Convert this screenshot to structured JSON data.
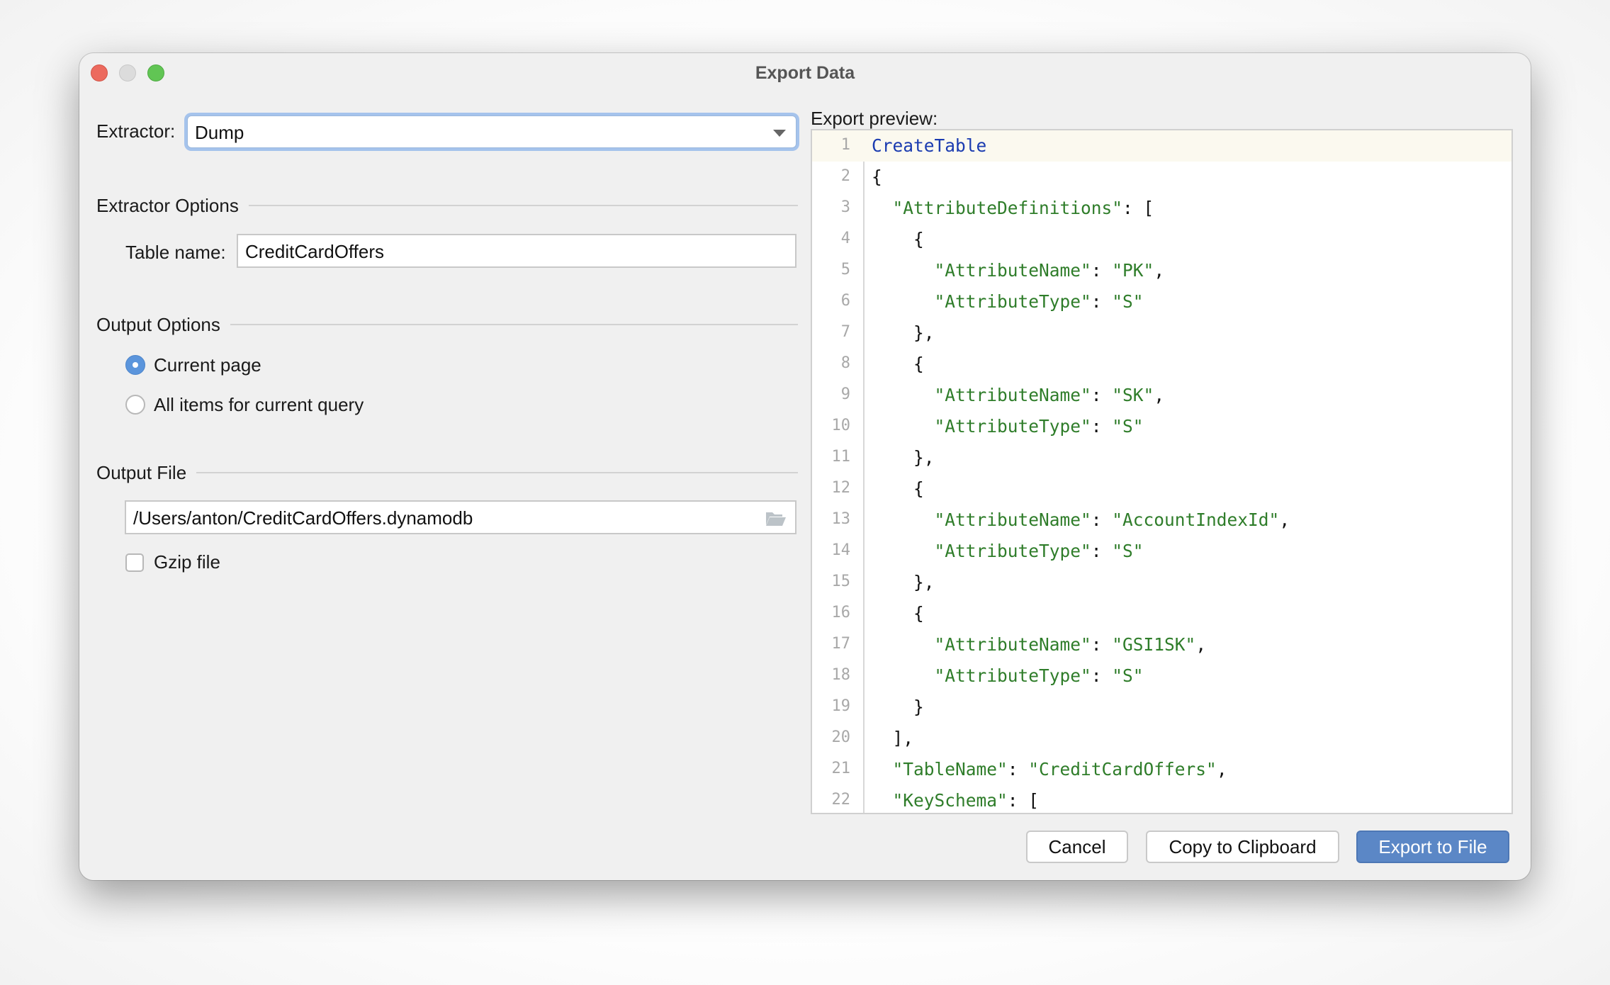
{
  "window": {
    "title": "Export Data",
    "controls": [
      "close",
      "minimize",
      "zoom"
    ]
  },
  "extractor": {
    "label": "Extractor:",
    "selected": "Dump"
  },
  "extractor_options": {
    "heading": "Extractor Options",
    "table_name_label": "Table name:",
    "table_name_value": "CreditCardOffers"
  },
  "output_options": {
    "heading": "Output Options",
    "radios": [
      {
        "label": "Current page",
        "selected": true
      },
      {
        "label": "All items for current query",
        "selected": false
      }
    ]
  },
  "output_file": {
    "heading": "Output File",
    "path": "/Users/anton/CreditCardOffers.dynamodb",
    "browse_icon": "folder-icon",
    "gzip_label": "Gzip file",
    "gzip_checked": false
  },
  "preview": {
    "label": "Export preview:",
    "current_line": 1,
    "lines": [
      {
        "n": "1",
        "tokens": [
          [
            "kw",
            "CreateTable"
          ]
        ]
      },
      {
        "n": "2",
        "tokens": [
          [
            "pun",
            "{"
          ]
        ]
      },
      {
        "n": "3",
        "tokens": [
          [
            "pun",
            "  "
          ],
          [
            "str",
            "\"AttributeDefinitions\""
          ],
          [
            "pun",
            ": ["
          ]
        ]
      },
      {
        "n": "4",
        "tokens": [
          [
            "pun",
            "    {"
          ]
        ]
      },
      {
        "n": "5",
        "tokens": [
          [
            "pun",
            "      "
          ],
          [
            "str",
            "\"AttributeName\""
          ],
          [
            "pun",
            ": "
          ],
          [
            "str",
            "\"PK\""
          ],
          [
            "pun",
            ","
          ]
        ]
      },
      {
        "n": "6",
        "tokens": [
          [
            "pun",
            "      "
          ],
          [
            "str",
            "\"AttributeType\""
          ],
          [
            "pun",
            ": "
          ],
          [
            "str",
            "\"S\""
          ]
        ]
      },
      {
        "n": "7",
        "tokens": [
          [
            "pun",
            "    },"
          ]
        ]
      },
      {
        "n": "8",
        "tokens": [
          [
            "pun",
            "    {"
          ]
        ]
      },
      {
        "n": "9",
        "tokens": [
          [
            "pun",
            "      "
          ],
          [
            "str",
            "\"AttributeName\""
          ],
          [
            "pun",
            ": "
          ],
          [
            "str",
            "\"SK\""
          ],
          [
            "pun",
            ","
          ]
        ]
      },
      {
        "n": "10",
        "tokens": [
          [
            "pun",
            "      "
          ],
          [
            "str",
            "\"AttributeType\""
          ],
          [
            "pun",
            ": "
          ],
          [
            "str",
            "\"S\""
          ]
        ]
      },
      {
        "n": "11",
        "tokens": [
          [
            "pun",
            "    },"
          ]
        ]
      },
      {
        "n": "12",
        "tokens": [
          [
            "pun",
            "    {"
          ]
        ]
      },
      {
        "n": "13",
        "tokens": [
          [
            "pun",
            "      "
          ],
          [
            "str",
            "\"AttributeName\""
          ],
          [
            "pun",
            ": "
          ],
          [
            "str",
            "\"AccountIndexId\""
          ],
          [
            "pun",
            ","
          ]
        ]
      },
      {
        "n": "14",
        "tokens": [
          [
            "pun",
            "      "
          ],
          [
            "str",
            "\"AttributeType\""
          ],
          [
            "pun",
            ": "
          ],
          [
            "str",
            "\"S\""
          ]
        ]
      },
      {
        "n": "15",
        "tokens": [
          [
            "pun",
            "    },"
          ]
        ]
      },
      {
        "n": "16",
        "tokens": [
          [
            "pun",
            "    {"
          ]
        ]
      },
      {
        "n": "17",
        "tokens": [
          [
            "pun",
            "      "
          ],
          [
            "str",
            "\"AttributeName\""
          ],
          [
            "pun",
            ": "
          ],
          [
            "str",
            "\"GSI1SK\""
          ],
          [
            "pun",
            ","
          ]
        ]
      },
      {
        "n": "18",
        "tokens": [
          [
            "pun",
            "      "
          ],
          [
            "str",
            "\"AttributeType\""
          ],
          [
            "pun",
            ": "
          ],
          [
            "str",
            "\"S\""
          ]
        ]
      },
      {
        "n": "19",
        "tokens": [
          [
            "pun",
            "    }"
          ]
        ]
      },
      {
        "n": "20",
        "tokens": [
          [
            "pun",
            "  ],"
          ]
        ]
      },
      {
        "n": "21",
        "tokens": [
          [
            "pun",
            "  "
          ],
          [
            "str",
            "\"TableName\""
          ],
          [
            "pun",
            ": "
          ],
          [
            "str",
            "\"CreditCardOffers\""
          ],
          [
            "pun",
            ","
          ]
        ]
      },
      {
        "n": "22",
        "tokens": [
          [
            "pun",
            "  "
          ],
          [
            "str",
            "\"KeySchema\""
          ],
          [
            "pun",
            ": ["
          ]
        ]
      }
    ]
  },
  "buttons": {
    "cancel": "Cancel",
    "copy": "Copy to Clipboard",
    "export": "Export to File"
  },
  "colors": {
    "accent": "#5b87c6",
    "keyword": "#1a3bb0",
    "string": "#2f7d2a",
    "current_line_bg": "#fbf9ef"
  }
}
